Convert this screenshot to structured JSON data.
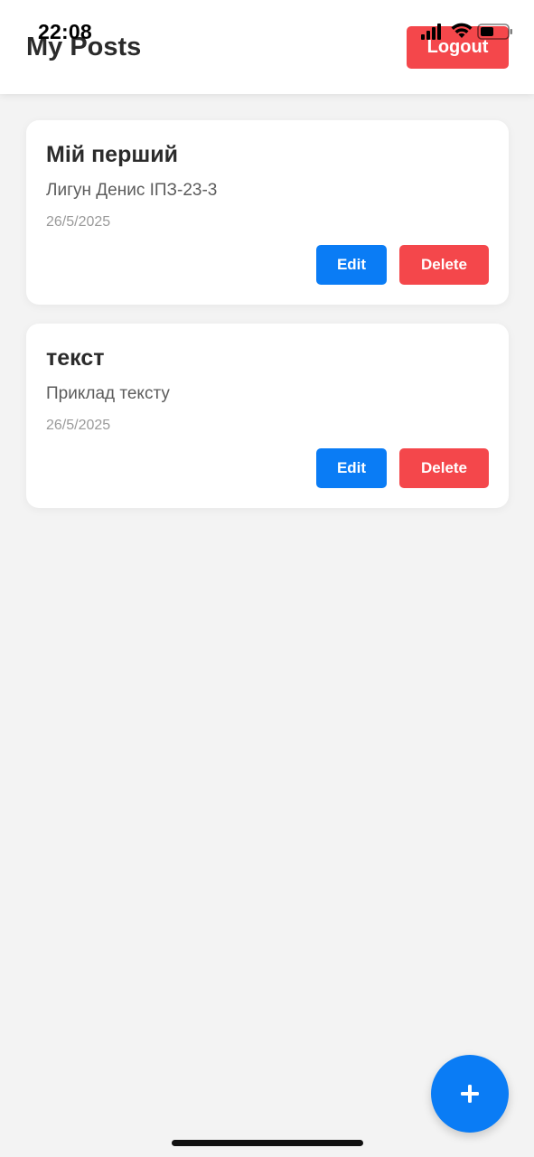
{
  "status_bar": {
    "time": "22:08",
    "icons": [
      "signal-icon",
      "wifi-icon",
      "battery-icon"
    ]
  },
  "header": {
    "title": "My Posts",
    "logout_label": "Logout"
  },
  "posts": [
    {
      "title": "Мій перший",
      "body": "Лигун Денис ІПЗ-23-3",
      "date": "26/5/2025",
      "edit_label": "Edit",
      "delete_label": "Delete"
    },
    {
      "title": "текст",
      "body": "Приклад тексту",
      "date": "26/5/2025",
      "edit_label": "Edit",
      "delete_label": "Delete"
    }
  ],
  "fab": {
    "icon": "plus-icon"
  },
  "colors": {
    "primary": "#0a7cf5",
    "danger": "#f4474b",
    "background": "#f3f3f3",
    "card": "#ffffff"
  }
}
